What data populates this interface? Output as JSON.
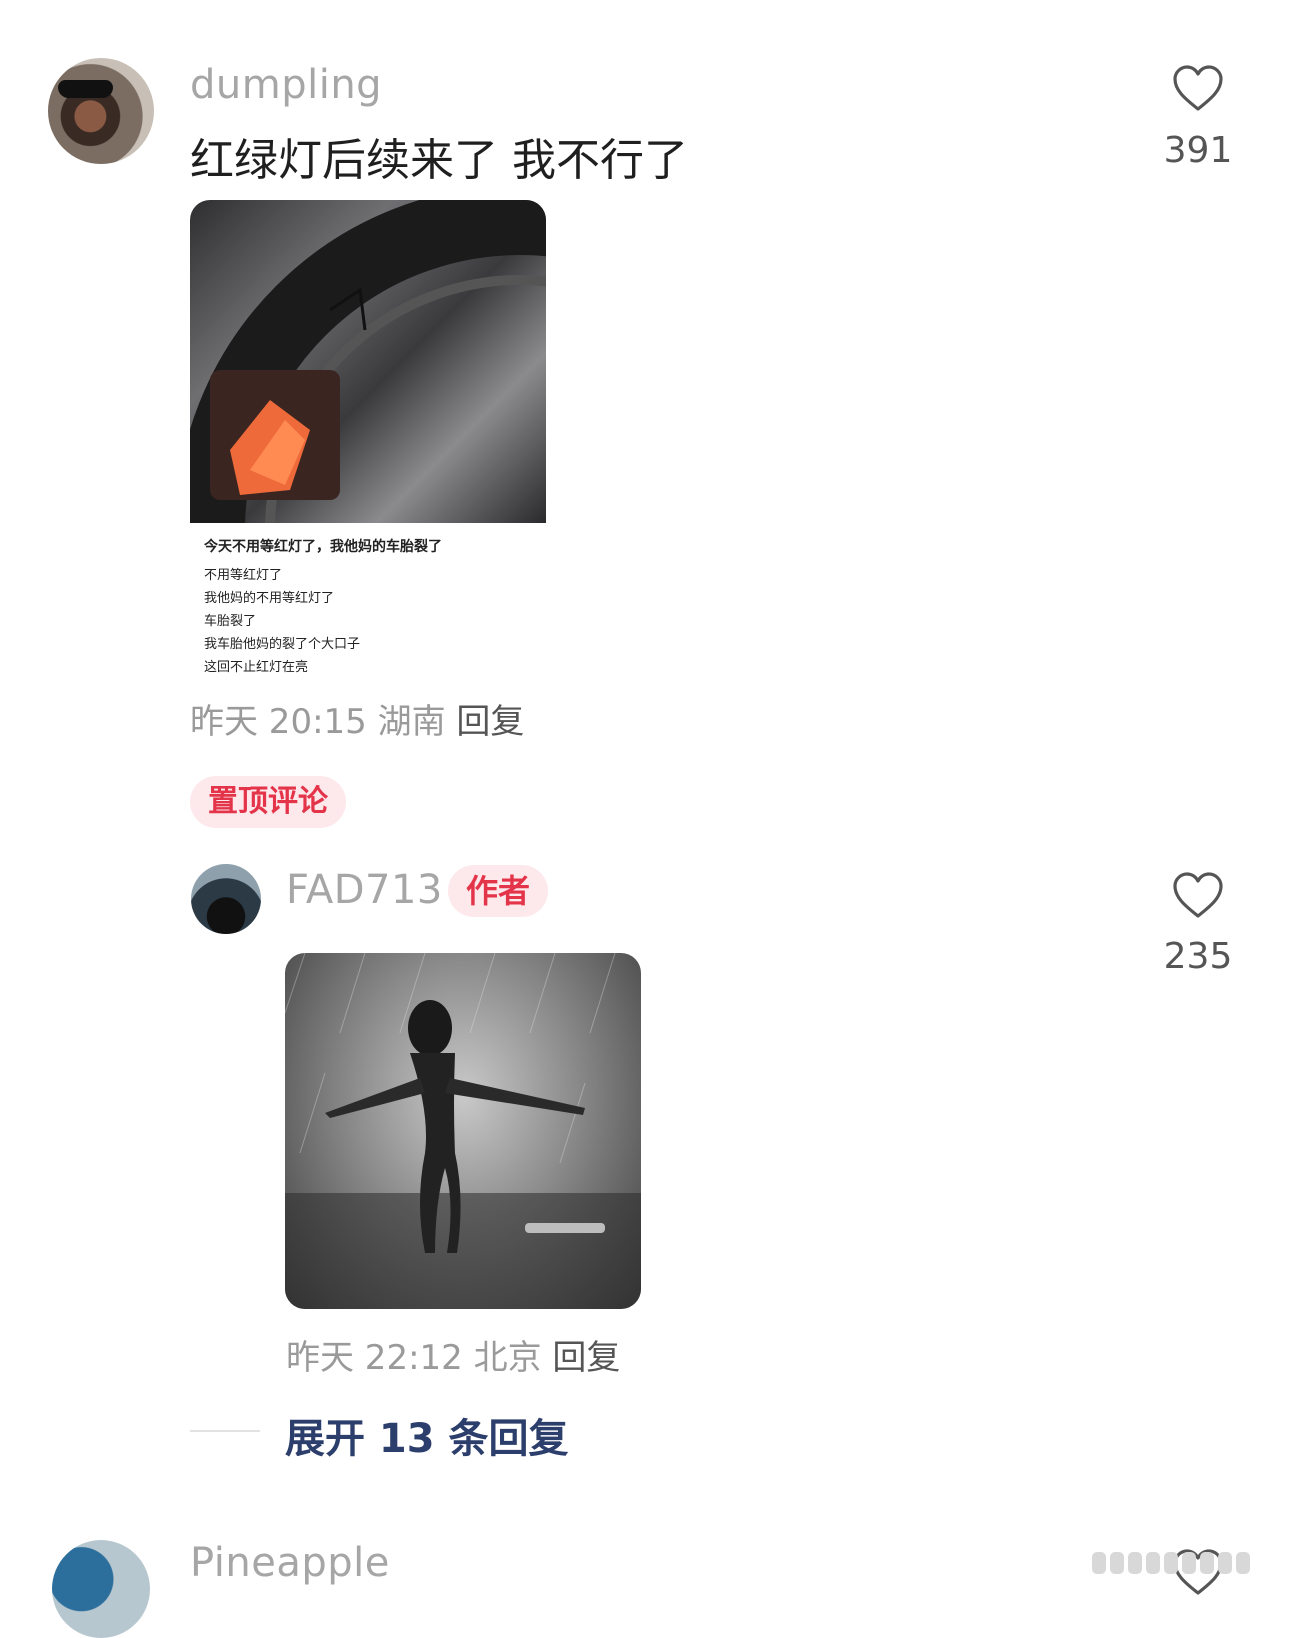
{
  "comments": [
    {
      "username": "dumpling",
      "text": "红绿灯后续来了 我不行了",
      "likes": "391",
      "image_caption_lines": [
        "今天不用等红灯了，我他妈的车胎裂了",
        "不用等红灯了",
        "我他妈的不用等红灯了",
        "车胎裂了",
        "我车胎他妈的裂了个大口子",
        "这回不止红灯在亮"
      ],
      "meta": {
        "time": "昨天 20:15",
        "location": "湖南",
        "reply_label": "回复"
      },
      "pinned_label": "置顶评论"
    }
  ],
  "reply": {
    "username": "FAD713",
    "author_badge": "作者",
    "likes": "235",
    "meta": {
      "time": "昨天 22:12",
      "location": "北京",
      "reply_label": "回复"
    }
  },
  "expand_replies_label": "展开 13 条回复",
  "next_comment": {
    "username": "Pineapple"
  },
  "colors": {
    "accent_red": "#e4344a",
    "link_blue": "#2c3e6b",
    "badge_bg": "#fde8ec"
  },
  "icons": {
    "like": "heart-outline-icon"
  }
}
